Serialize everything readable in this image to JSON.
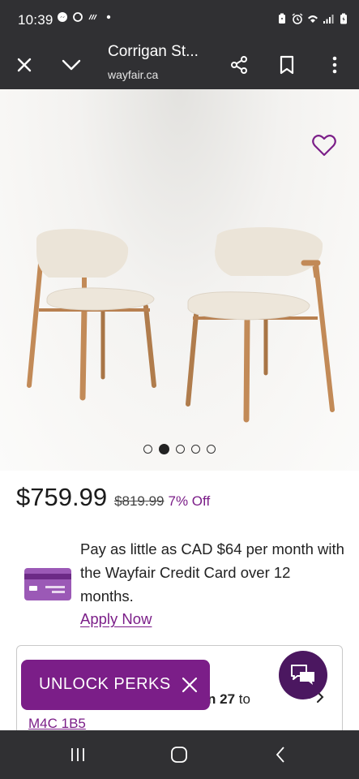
{
  "status_bar": {
    "time": "10:39",
    "left_icons": [
      "messenger-icon",
      "sync-icon",
      "missed-call-icon",
      "dot-icon"
    ],
    "right_icons": [
      "battery-saver-icon",
      "alarm-icon",
      "wifi-icon",
      "signal-icon",
      "battery-icon"
    ]
  },
  "browser": {
    "title": "Corrigan St...",
    "domain": "wayfair.ca",
    "buttons": [
      "close-icon",
      "chevron-down-icon",
      "share-icon",
      "bookmark-icon",
      "more-vert-icon"
    ]
  },
  "product": {
    "image_subject": "two-beige-upholstered-dining-chairs",
    "carousel": {
      "total": 5,
      "active_index": 1
    }
  },
  "price": {
    "current": "$759.99",
    "original": "$819.99",
    "discount": "7% Off"
  },
  "financing": {
    "text": "Pay as little as CAD $64 per month with the Wayfair Credit Card over 12 months.",
    "link": "Apply Now"
  },
  "delivery": {
    "date_prefix_fragment": "n",
    "date_bold": "27",
    "date_suffix": "to",
    "postal_code": "M4C 1B5"
  },
  "unlock_perks": {
    "label": "UNLOCK PERKS"
  },
  "colors": {
    "brand_purple": "#7b1e88",
    "chat_purple": "#4b1760",
    "system_bar": "#303033"
  }
}
